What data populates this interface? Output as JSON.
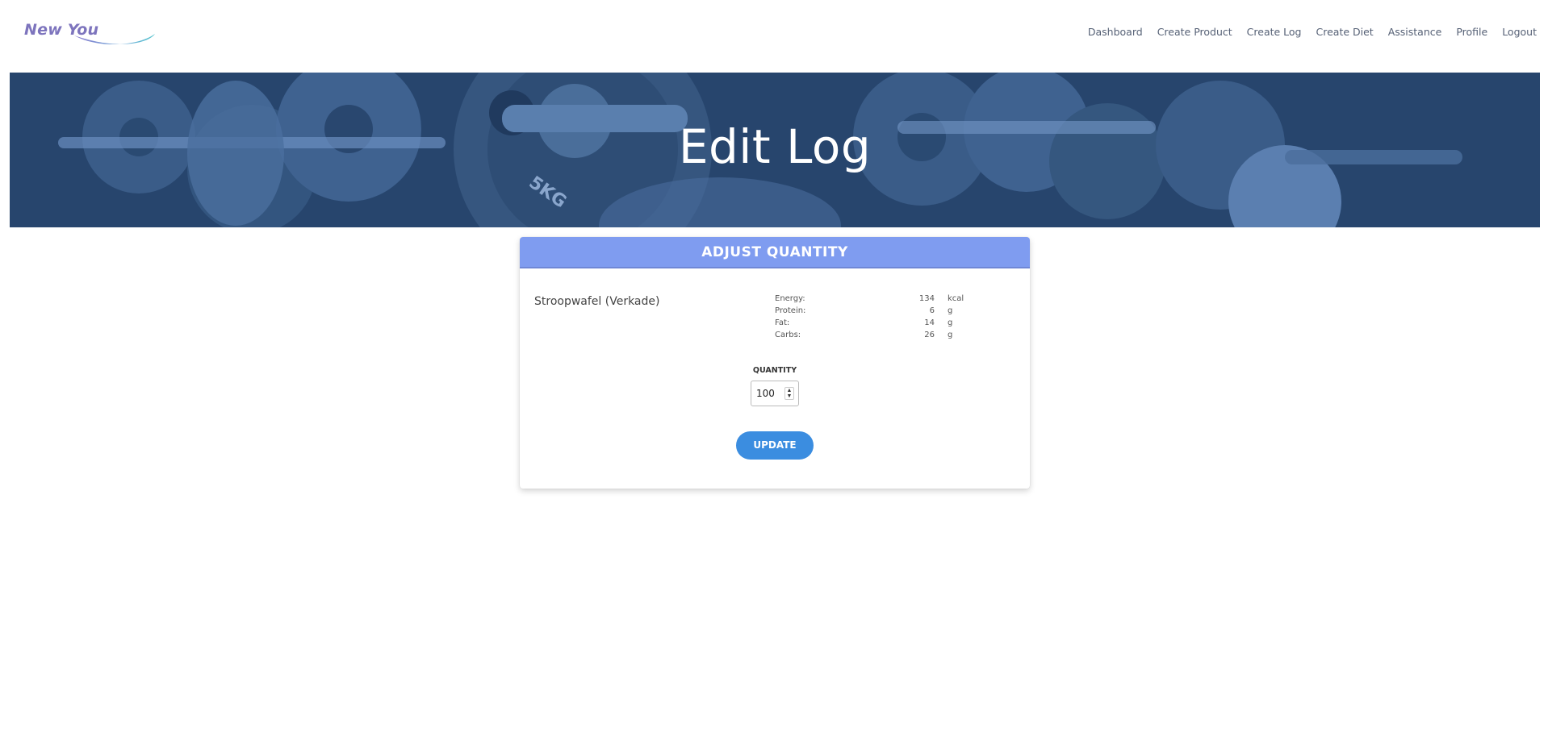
{
  "header": {
    "logo_text": "New You",
    "nav": [
      "Dashboard",
      "Create Product",
      "Create Log",
      "Create Diet",
      "Assistance",
      "Profile",
      "Logout"
    ]
  },
  "hero": {
    "title": "Edit Log",
    "plate_text": "5KG"
  },
  "card": {
    "title": "ADJUST QUANTITY",
    "product_name": "Stroopwafel (Verkade)",
    "nutrition": [
      {
        "label": "Energy:",
        "value": "134",
        "unit": "kcal"
      },
      {
        "label": "Protein:",
        "value": "6",
        "unit": "g"
      },
      {
        "label": "Fat:",
        "value": "14",
        "unit": "g"
      },
      {
        "label": "Carbs:",
        "value": "26",
        "unit": "g"
      }
    ],
    "quantity_label": "QUANTITY",
    "quantity_value": "100",
    "update_label": "UPDATE"
  },
  "colors": {
    "hero_bg": "#27456d",
    "card_header": "#7f9cf0",
    "button": "#3b8de0",
    "logo": "#7d74bd"
  }
}
